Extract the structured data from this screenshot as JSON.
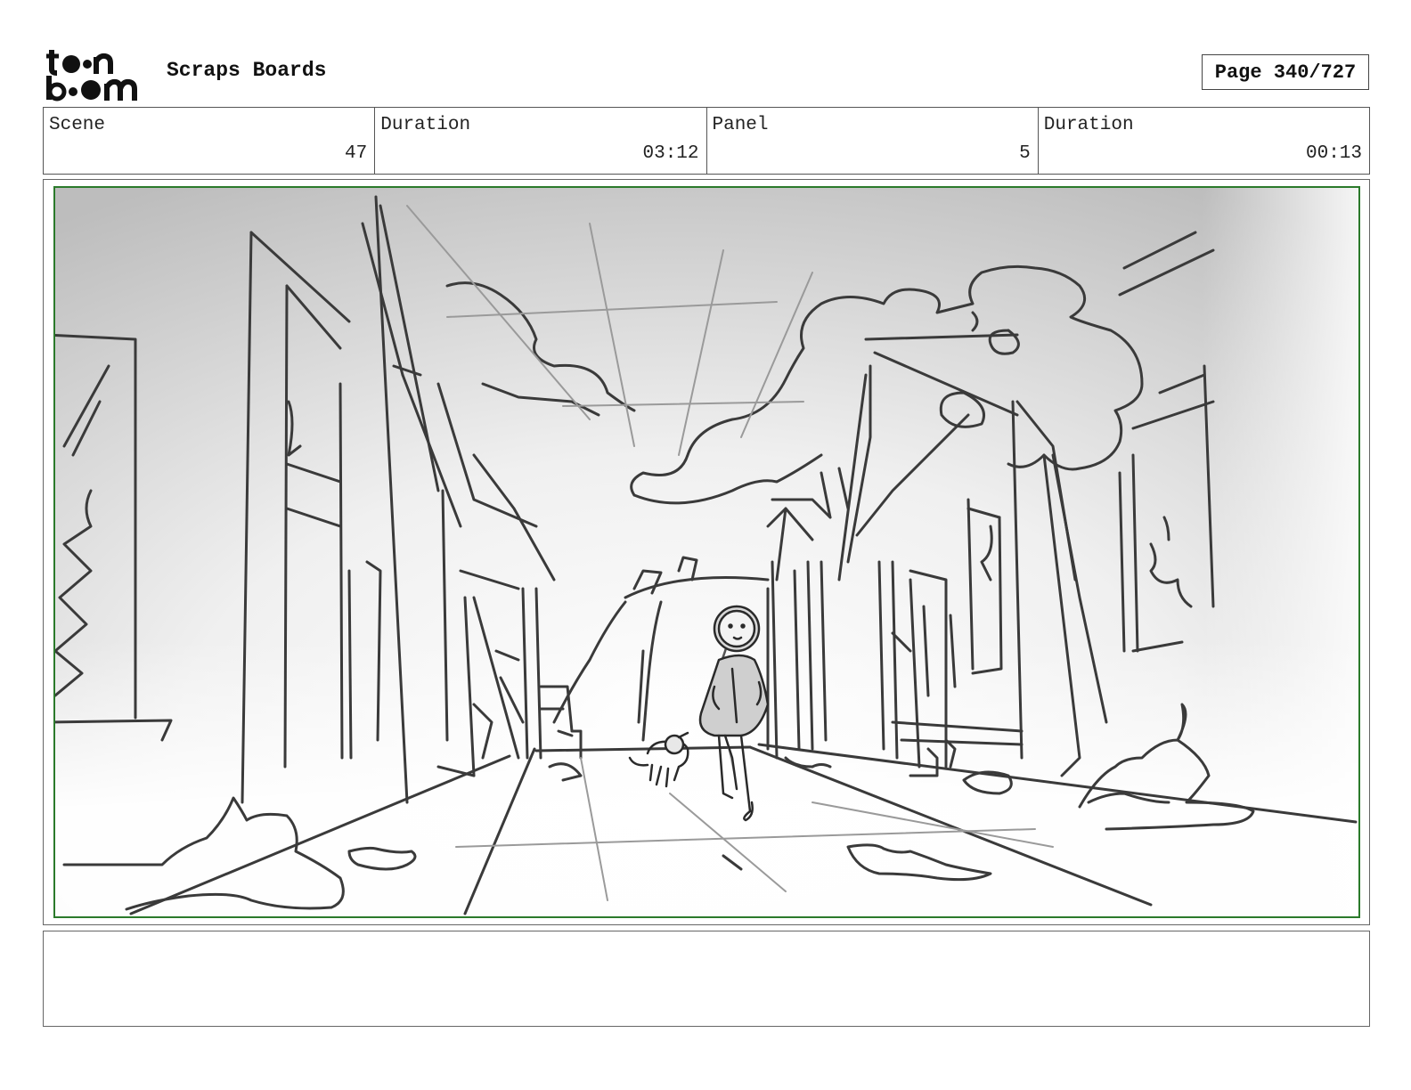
{
  "header": {
    "logo_text": "toonboom",
    "project_title": "Scraps Boards",
    "page_label": "Page 340/727"
  },
  "info": {
    "scene_label": "Scene",
    "scene_value": "47",
    "scene_duration_label": "Duration",
    "scene_duration_value": "03:12",
    "panel_label": "Panel",
    "panel_value": "5",
    "panel_duration_label": "Duration",
    "panel_duration_value": "00:13"
  },
  "panel": {
    "description": "",
    "border_color": "#2b7a2b"
  },
  "notes": {
    "text": ""
  }
}
